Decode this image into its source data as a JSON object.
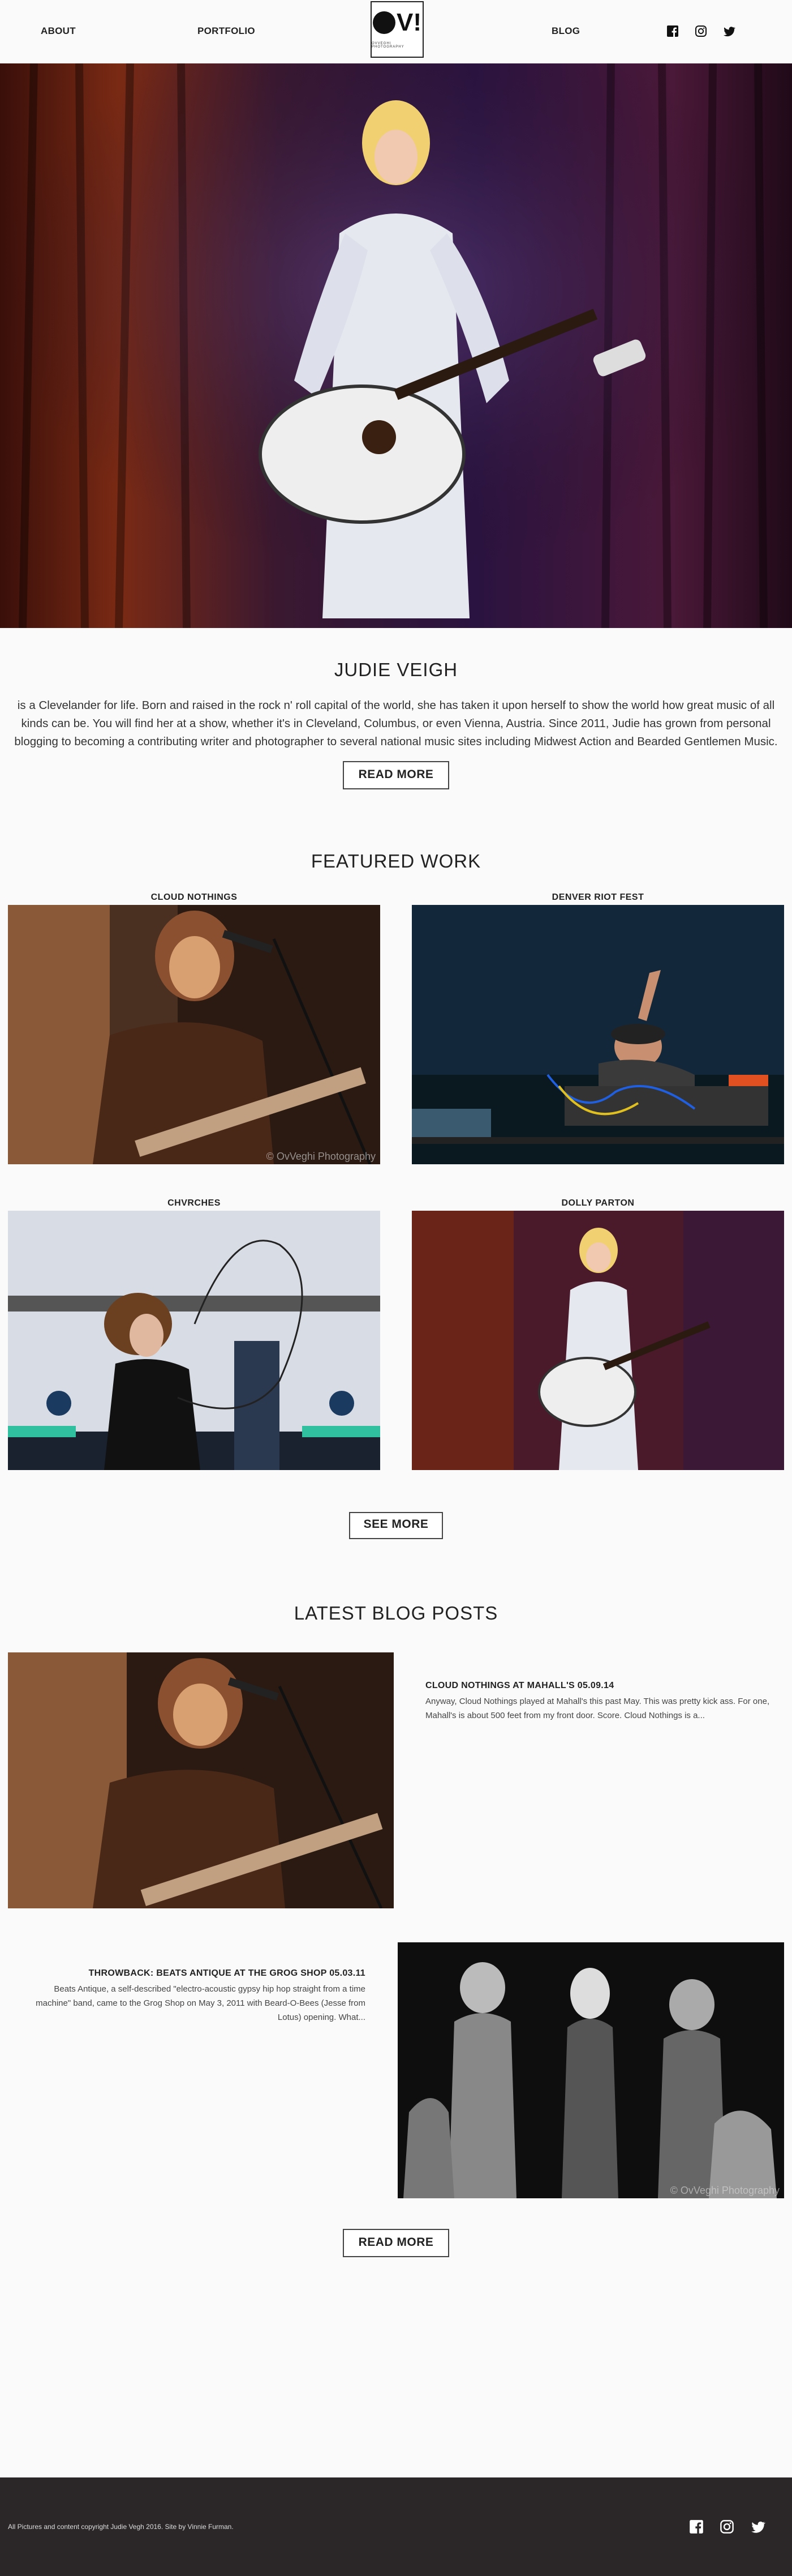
{
  "nav": {
    "about": "ABOUT",
    "portfolio": "PORTFOLIO",
    "blog": "BLOG"
  },
  "logo": {
    "mark": "OV!",
    "tagline": "OVVEGHI PHOTOGRAPHY"
  },
  "socials": [
    "facebook-icon",
    "instagram-icon",
    "twitter-icon"
  ],
  "about": {
    "title": "JUDIE VEIGH",
    "body": "is a Clevelander for life. Born and raised in the rock n' roll capital of the world, she has taken it upon herself to show the world how great music of all kinds can be. You will find her at a show, whether it's in Cleveland, Columbus, or even Vienna, Austria. Since 2011, Judie has grown from personal blogging to becoming a contributing writer and photographer to several national music sites including Midwest Action and Bearded Gentlemen Music.",
    "button": "READ MORE"
  },
  "featured": {
    "title": "FEATURED WORK",
    "items": [
      {
        "title": "CLOUD NOTHINGS",
        "watermark": "© OvVeghi Photography"
      },
      {
        "title": "DENVER RIOT FEST"
      },
      {
        "title": "CHVRCHES"
      },
      {
        "title": "DOLLY PARTON"
      }
    ],
    "button": "SEE MORE"
  },
  "blog": {
    "title": "LATEST BLOG POSTS",
    "posts": [
      {
        "title": "CLOUD NOTHINGS AT MAHALL'S 05.09.14",
        "excerpt": "Anyway, Cloud Nothings played at Mahall's this past May. This was pretty kick ass. For one, Mahall's is about 500 feet from my front door. Score. Cloud Nothings is a..."
      },
      {
        "title": "THROWBACK: BEATS ANTIQUE AT THE GROG SHOP 05.03.11",
        "excerpt": "Beats Antique, a self-described \"electro-acoustic gypsy hip hop straight from a time machine\" band, came to the Grog Shop on May 3, 2011 with Beard-O-Bees (Jesse from Lotus) opening. What...",
        "watermark": "© OvVeghi Photography"
      }
    ],
    "button": "READ MORE"
  },
  "footer": {
    "copyright": "All Pictures and content copyright Judie Vegh 2016. Site by Vinnie Furman."
  }
}
